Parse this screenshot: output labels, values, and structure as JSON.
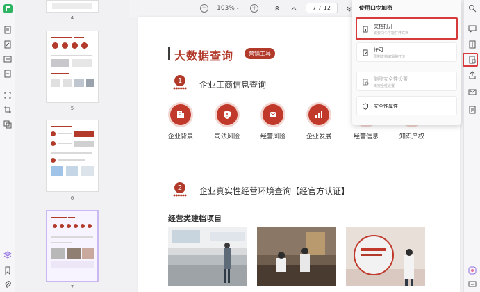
{
  "toolbar": {
    "zoom_out_label": "−",
    "zoom_level": "103%",
    "zoom_in_label": "+",
    "page_current": "7",
    "page_separator": "/",
    "page_total": "12"
  },
  "thumbnails": [
    {
      "label": "4"
    },
    {
      "label": "5"
    },
    {
      "label": "6"
    },
    {
      "label": "7",
      "selected": true
    }
  ],
  "document": {
    "title": "大数据查询",
    "badge": "营销工具",
    "section1": {
      "number": "1",
      "title": "企业工商信息查询"
    },
    "features": [
      {
        "label": "企业背景",
        "icon": "building-icon"
      },
      {
        "label": "司法风险",
        "icon": "alert-shield-icon"
      },
      {
        "label": "经营风险",
        "icon": "mail-shield-icon"
      },
      {
        "label": "企业发展",
        "icon": "bar-chart-icon"
      },
      {
        "label": "经营信息",
        "icon": "info-icon"
      },
      {
        "label": "知识产权",
        "icon": "ip-icon"
      }
    ],
    "section2": {
      "number": "2",
      "title": "企业真实性经营环境查询【经官方认证】"
    },
    "subheading": "经营类建档项目"
  },
  "security_menu": {
    "title": "使用口令加密",
    "items": [
      {
        "label": "文档打开",
        "sublabel": "需要口令才能打开文档",
        "icon": "document-lock-icon",
        "disabled": false,
        "highlighted": true
      },
      {
        "label": "许可",
        "sublabel": "限制文档编辑和打印",
        "icon": "permission-icon",
        "disabled": false
      },
      {
        "label": "删除安全性设置",
        "sublabel": "无安全性设置",
        "icon": "remove-security-icon",
        "disabled": true
      },
      {
        "label": "安全性属性",
        "sublabel": "",
        "icon": "security-properties-icon",
        "disabled": false
      }
    ]
  },
  "colors": {
    "brand_red": "#b23a2a",
    "highlight_red": "#d63a3a",
    "selected_thumb": "#c9b8f2"
  }
}
